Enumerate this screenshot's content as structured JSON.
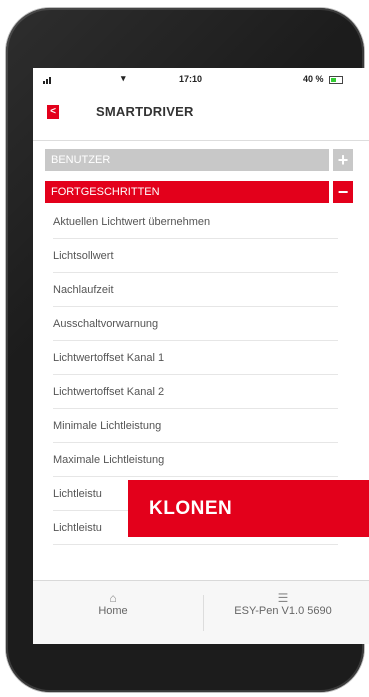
{
  "status_bar": {
    "time": "17:10",
    "battery": "40 %"
  },
  "header": {
    "title": "SMARTDRIVER",
    "back_label": "<"
  },
  "sections": {
    "user": {
      "label": "BENUTZER",
      "toggle": "+"
    },
    "advanced": {
      "label": "FORTGESCHRITTEN",
      "toggle": "−"
    }
  },
  "list_items": [
    "Aktuellen Lichtwert übernehmen",
    "Lichtsollwert",
    "Nachlaufzeit",
    "Ausschaltvorwarnung",
    "Lichtwertoffset Kanal 1",
    "Lichtwertoffset Kanal 2",
    "Minimale Lichtleistung",
    "Maximale Lichtleistung",
    "Lichtleistu",
    "Lichtleistu"
  ],
  "tab_bar": {
    "home_label": "Home",
    "device_label": "ESY-Pen V1.0 5690"
  },
  "overlay": {
    "label": "KLONEN"
  },
  "colors": {
    "accent": "#e3001b",
    "section_inactive": "#c8c8c8"
  }
}
